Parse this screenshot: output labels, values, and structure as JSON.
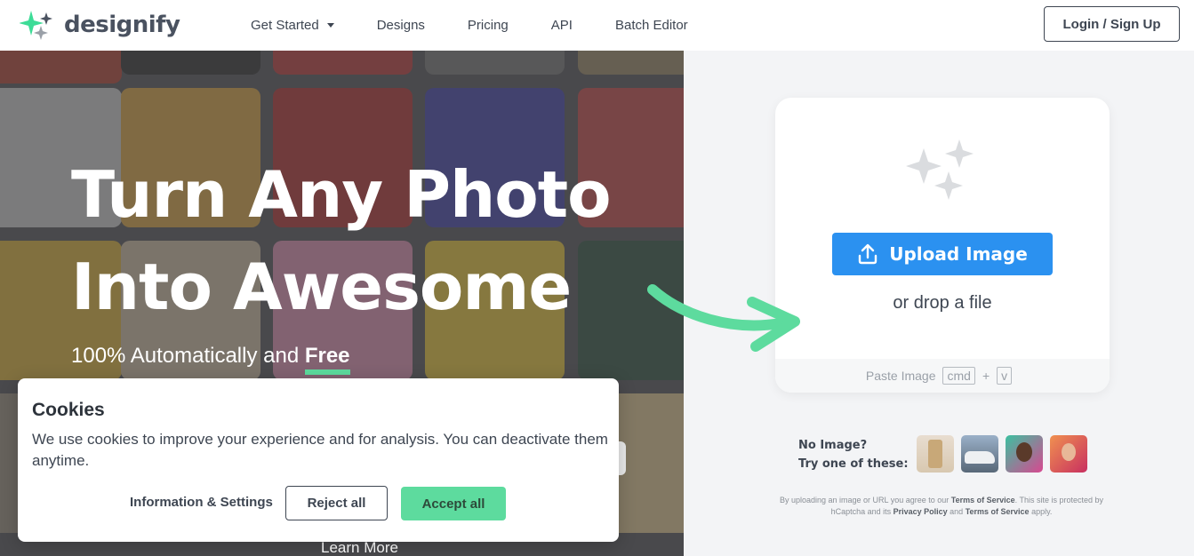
{
  "header": {
    "brand": "designify",
    "nav": [
      {
        "label": "Get Started",
        "dropdown": true
      },
      {
        "label": "Designs"
      },
      {
        "label": "Pricing"
      },
      {
        "label": "API"
      },
      {
        "label": "Batch Editor"
      }
    ],
    "login_label": "Login / Sign Up"
  },
  "hero": {
    "title_line1": "Turn Any Photo",
    "title_line2": "Into Awesome",
    "subtitle_prefix": "100% Automatically and ",
    "subtitle_bold": "Free",
    "learn_more": "Learn More"
  },
  "upload": {
    "button_label": "Upload Image",
    "drop_text": "or drop a file",
    "paste_label": "Paste Image",
    "key1": "cmd",
    "plus": "+",
    "key2": "v"
  },
  "samples": {
    "line1": "No Image?",
    "line2": "Try one of these:",
    "items": [
      "product-sample",
      "car-sample",
      "person-sample",
      "portrait-sample"
    ]
  },
  "legal": {
    "part1": "By uploading an image or URL you agree to our ",
    "tos": "Terms of Service",
    "part2": ". This site is protected by hCaptcha and its ",
    "privacy": "Privacy Policy",
    "part3": " and ",
    "tos2": "Terms of Service",
    "part4": " apply."
  },
  "cookie": {
    "title": "Cookies",
    "text": "We use cookies to improve your experience and for analysis. You can deactivate them anytime.",
    "info_label": "Information & Settings",
    "reject_label": "Reject all",
    "accept_label": "Accept all"
  },
  "colors": {
    "brand_green": "#5ddb9e",
    "upload_blue": "#2b91f0",
    "text_dark": "#3e4652"
  }
}
